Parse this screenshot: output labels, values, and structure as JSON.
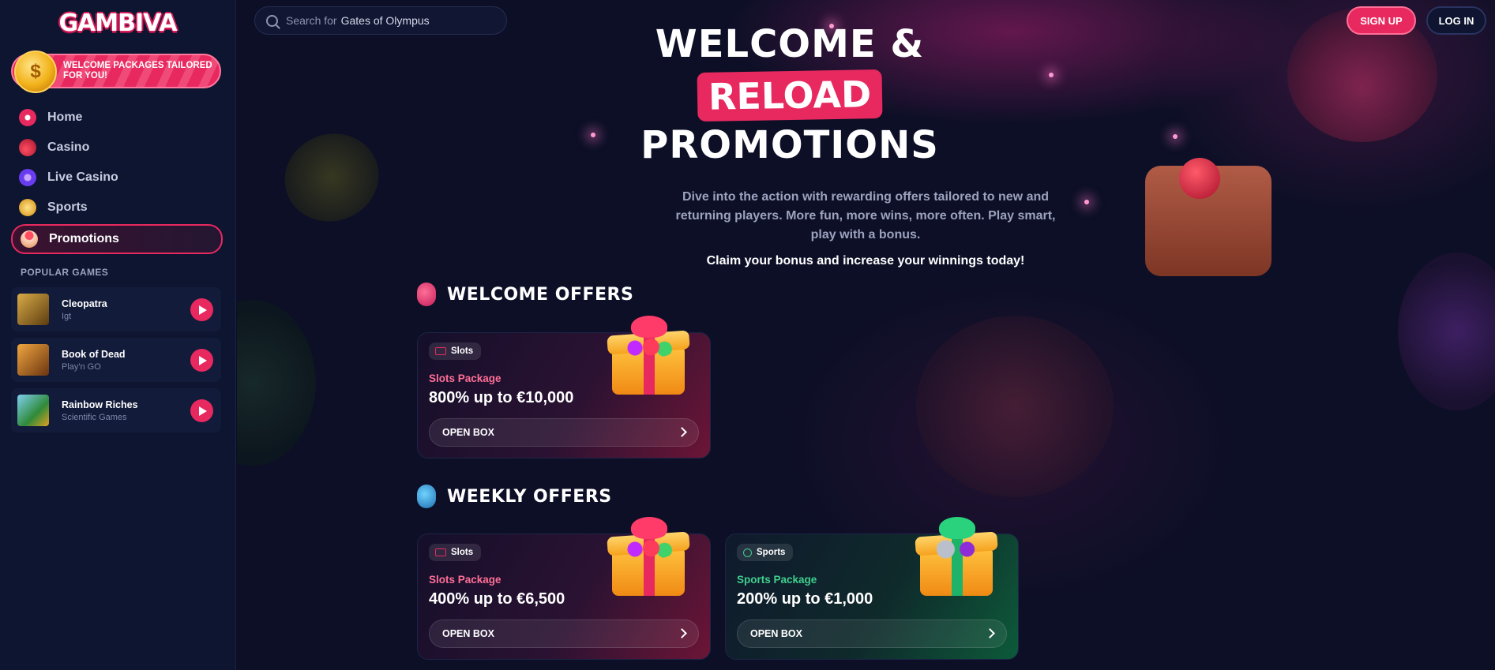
{
  "brand": {
    "logo_text": "GAMBIVA"
  },
  "sidebar": {
    "promo_banner": "WELCOME PACKAGES TAILORED FOR YOU!",
    "nav": [
      {
        "label": "Home",
        "icon": "swirl-candy-icon",
        "color": "#e8295f"
      },
      {
        "label": "Casino",
        "icon": "cherry-icon",
        "color": "#c41d3f"
      },
      {
        "label": "Live Casino",
        "icon": "flower-candy-icon",
        "color": "#6a3cf0"
      },
      {
        "label": "Sports",
        "icon": "medal-icon",
        "color": "#f2b21a"
      },
      {
        "label": "Promotions",
        "icon": "cupcake-icon",
        "color": "#ff8aa8",
        "active": true
      }
    ],
    "popular_title": "POPULAR GAMES",
    "games": [
      {
        "name": "Cleopatra",
        "provider": "Igt",
        "thumb_color": "#8a6a24"
      },
      {
        "name": "Book of Dead",
        "provider": "Play'n GO",
        "thumb_color": "#b0701c"
      },
      {
        "name": "Rainbow Riches",
        "provider": "Scientific Games",
        "thumb_color": "#3f8a4a"
      }
    ]
  },
  "header": {
    "search": {
      "label": "Search for",
      "value": "Gates of Olympus"
    },
    "signup_label": "SIGN UP",
    "login_label": "LOG IN"
  },
  "hero": {
    "line1": "WELCOME &",
    "highlight": "RELOAD",
    "line3": "PROMOTIONS",
    "description": "Dive into the action with rewarding offers tailored to new and returning players. More fun, more wins, more often. Play smart, play with a bonus.",
    "claim": "Claim your bonus and increase your winnings today!"
  },
  "sections": {
    "welcome": {
      "title": "WELCOME OFFERS",
      "icon": "pink-candy-icon",
      "cards": [
        {
          "tag": "Slots",
          "package": "Slots Package",
          "amount": "800% up to €10,000",
          "button": "OPEN BOX",
          "theme": "pink"
        }
      ]
    },
    "weekly": {
      "title": "WEEKLY OFFERS",
      "icon": "blue-candy-icon",
      "cards": [
        {
          "tag": "Slots",
          "package": "Slots Package",
          "amount": "400% up to €6,500",
          "button": "OPEN BOX",
          "theme": "pink"
        },
        {
          "tag": "Sports",
          "package": "Sports Package",
          "amount": "200% up to €1,000",
          "button": "OPEN BOX",
          "theme": "green"
        }
      ]
    }
  },
  "colors": {
    "accent": "#e8295f",
    "sidebar_bg": "#0d1530",
    "main_bg": "#0c0f26",
    "sports_accent": "#3fcf8e"
  }
}
